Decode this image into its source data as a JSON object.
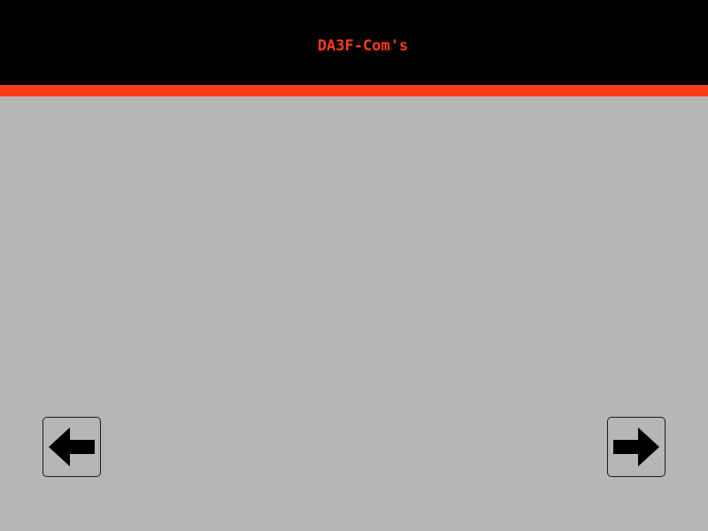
{
  "header": {
    "title": "DA3F-Com's",
    "background_color": "#000000",
    "title_color": "#ff3d17",
    "accent_color": "#ff3d17"
  },
  "content": {
    "background_color": "#b6b6b6"
  },
  "navigation": {
    "prev_icon": "arrow-left-icon",
    "next_icon": "arrow-right-icon"
  }
}
